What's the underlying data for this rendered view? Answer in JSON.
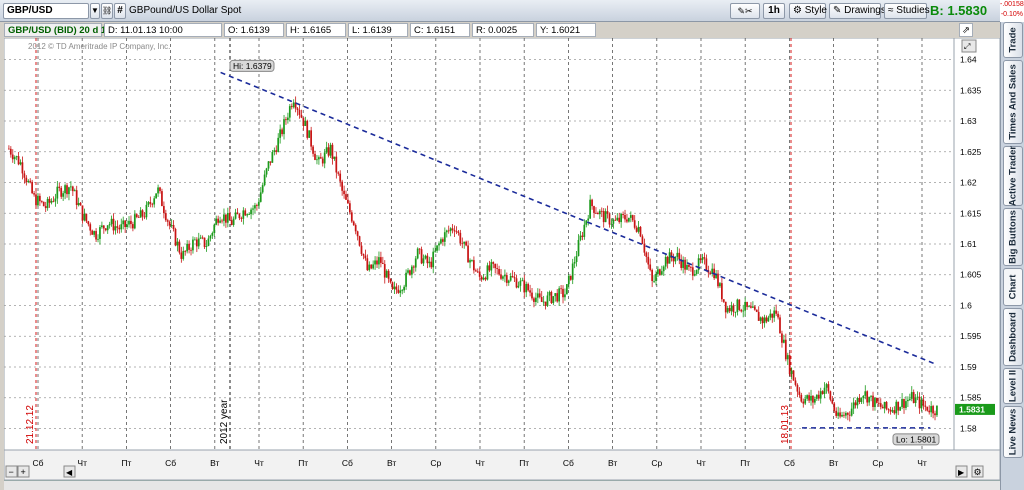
{
  "toolbar": {
    "symbol": "GBP/USD",
    "hash_label": "#",
    "description": "GBPound/US Dollar Spot",
    "timeframe": "1h",
    "style_label": "Style",
    "drawings_label": "Drawings",
    "studies_label": "Studies",
    "bid": "B: 1.5830",
    "change_abs": "-.00158",
    "change_pct": "-0.10%"
  },
  "infobar": {
    "title": "GBP/USD (BID) 20 d 1h",
    "date": "D: 11.01.13 10:00",
    "open": "O: 1.6139",
    "high": "H: 1.6165",
    "low": "L: 1.6139",
    "close": "C: 1.6151",
    "range": "R: 0.0025",
    "y": "Y: 1.6021"
  },
  "chart_data": {
    "type": "candlestick",
    "copyright": "2012 © TD Ameritrade IP Company, Inc.",
    "ylim": [
      1.5765,
      1.6435
    ],
    "y_ticks": [
      1.64,
      1.635,
      1.63,
      1.625,
      1.62,
      1.615,
      1.61,
      1.605,
      1.6,
      1.595,
      1.59,
      1.585,
      1.58
    ],
    "x_ticks": [
      "Сб",
      "Чт",
      "Пт",
      "Сб",
      "Вт",
      "Чт",
      "Пт",
      "Сб",
      "Вт",
      "Ср",
      "Чт",
      "Пт",
      "Сб",
      "Вт",
      "Ср",
      "Чт",
      "Пт",
      "Сб",
      "Вт",
      "Ср",
      "Чт"
    ],
    "markers": [
      {
        "label": "21.12.12",
        "color": "#d00000"
      },
      {
        "label": "2012 year",
        "color": "#000000"
      },
      {
        "label": "18.01.13",
        "color": "#d00000"
      }
    ],
    "high_label": "Hi: 1.6379",
    "low_label": "Lo: 1.5801",
    "last_price": "1.5831",
    "close_path": [
      1.6255,
      1.623,
      1.6175,
      1.616,
      1.6185,
      1.6195,
      1.6145,
      1.6115,
      1.6135,
      1.6125,
      1.6135,
      1.615,
      1.619,
      1.613,
      1.608,
      1.6105,
      1.61,
      1.615,
      1.6135,
      1.6155,
      1.616,
      1.623,
      1.628,
      1.634,
      1.629,
      1.623,
      1.6255,
      1.618,
      1.613,
      1.6055,
      1.6075,
      1.602,
      1.604,
      1.6085,
      1.6065,
      1.611,
      1.613,
      1.6085,
      1.6045,
      1.606,
      1.605,
      1.604,
      1.6025,
      1.6005,
      1.6015,
      1.602,
      1.6095,
      1.6165,
      1.6145,
      1.6135,
      1.6145,
      1.6125,
      1.6035,
      1.6075,
      1.608,
      1.6055,
      1.607,
      1.6055,
      1.5995,
      1.6,
      1.599,
      1.5975,
      1.599,
      1.5905,
      1.585,
      1.5845,
      1.587,
      1.5815,
      1.583,
      1.586,
      1.584,
      1.583,
      1.584,
      1.585,
      1.5835,
      1.5831
    ],
    "trend_lines": [
      {
        "from": [
          0.228,
          1.6379
        ],
        "to": [
          0.98,
          1.5905
        ],
        "color": "#1b2b9a",
        "style": "dashed"
      },
      {
        "from": [
          0.84,
          1.5801
        ],
        "to": [
          0.975,
          1.5801
        ],
        "color": "#1b2b9a",
        "style": "dashed"
      }
    ]
  },
  "sidetabs": [
    "Trade",
    "Times And Sales",
    "Active Trader",
    "Big Buttons",
    "Chart",
    "Dashboard",
    "Level II",
    "Live News"
  ]
}
